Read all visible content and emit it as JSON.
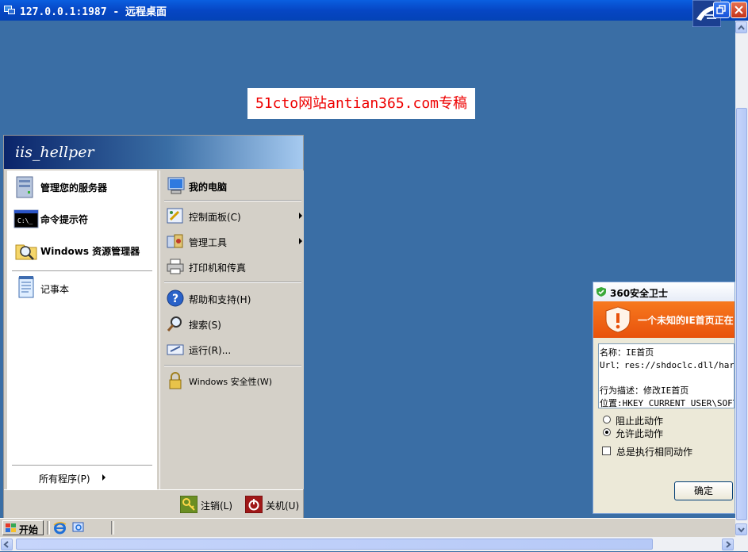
{
  "window": {
    "title": "127.0.0.1:1987 - 远程桌面"
  },
  "banner": {
    "text": "51cto网站antian365.com专稿"
  },
  "start_menu": {
    "user": "iis_hellper",
    "pinned": [
      {
        "label": "管理您的服务器",
        "icon": "server-manage-icon"
      },
      {
        "label": "命令提示符",
        "icon": "cmd-prompt-icon"
      },
      {
        "label": "Windows 资源管理器",
        "icon": "explorer-folder-icon"
      }
    ],
    "recent": [
      {
        "label": "记事本",
        "icon": "notepad-icon"
      }
    ],
    "all_programs": "所有程序(P)",
    "right": {
      "my_computer": "我的电脑",
      "control_panel": "控制面板(C)",
      "admin_tools": "管理工具",
      "printers": "打印机和传真",
      "help": "帮助和支持(H)",
      "search": "搜索(S)",
      "run": "运行(R)...",
      "security": "Windows 安全性(W)"
    },
    "logoff": "注销(L)",
    "shutdown": "关机(U)"
  },
  "taskbar": {
    "start": "开始"
  },
  "popup": {
    "title": "360安全卫士",
    "alert": "一个未知的IE首页正在",
    "details": {
      "name": "名称：IE首页",
      "url": "Url：res://shdoclc.dll/hardAd",
      "behavior": "行为描述：修改IE首页",
      "location": "位置:HKEY_CURRENT_USER\\SOFTWA"
    },
    "options": {
      "block": "阻止此动作",
      "allow": "允许此动作",
      "selected": "allow"
    },
    "always": "总是执行相同动作",
    "ok": "确定"
  },
  "colors": {
    "desktop": "#3a6ea5",
    "alert_orange": "#f26b16",
    "banner_text": "#ee0000"
  }
}
